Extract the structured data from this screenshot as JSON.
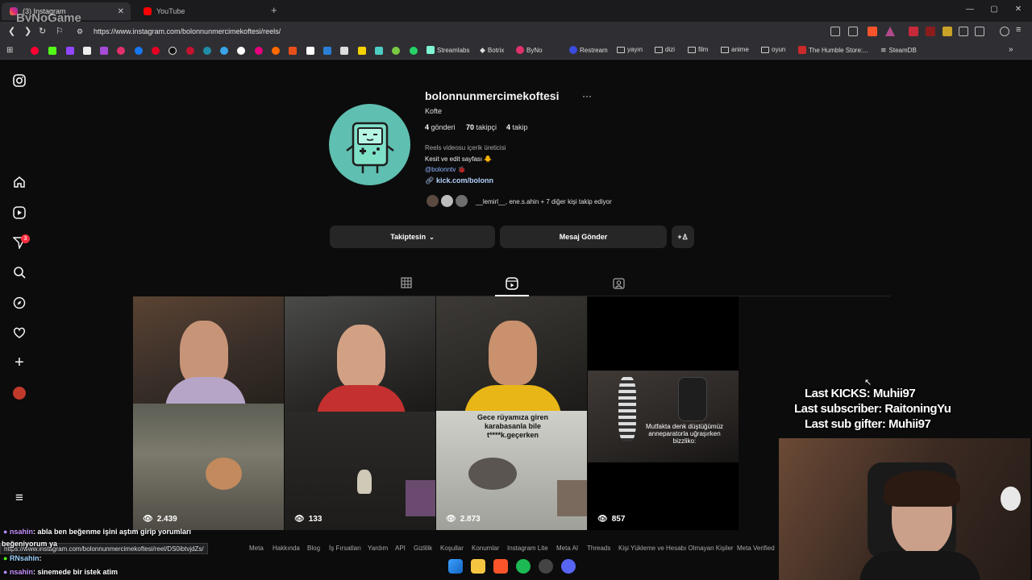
{
  "browser": {
    "tabs": [
      {
        "title": "(3) Instagram",
        "active": true
      },
      {
        "title": "YouTube",
        "active": false
      }
    ],
    "url": "https://www.instagram.com/bolonnunmercimekoftesi/reels/",
    "bookmarks": [
      "Streamlabs",
      "Botrix",
      "ByNo",
      "Restream",
      "yayın",
      "dizi",
      "film",
      "anime",
      "oyun",
      "The Humble Store:...",
      "SteamDB"
    ],
    "watermark": "ByNoGame"
  },
  "nav": {
    "notifications_count": "3"
  },
  "profile": {
    "username": "bolonnunmercimekoftesi",
    "full_name": "Kofte",
    "posts_count": "4",
    "posts_label": "gönderi",
    "followers_count": "70",
    "followers_label": "takipçi",
    "following_count": "4",
    "following_label": "takip",
    "category": "Reels videosu içerik üreticisi",
    "bio_line1": "Kesit ve edit sayfası 🐥",
    "bio_mention": "@bolonntv 🐞",
    "bio_link": "kick.com/bolonn",
    "mutual_text": "__lemirl__, ene.s.ahin + 7 diğer kişi takip ediyor",
    "following_button": "Takiptesin",
    "message_button": "Mesaj Gönder"
  },
  "reels": [
    {
      "views": "2.439",
      "caption": ""
    },
    {
      "views": "133",
      "caption": ""
    },
    {
      "views": "2.873",
      "caption": "Gece rüyamıza giren karabasanla bile t****k.geçerken"
    },
    {
      "views": "857",
      "caption": "Mutfakta denk düştüğümüz anneparatorla uğraşırken bizzliko:"
    }
  ],
  "footer": [
    "Meta",
    "Hakkında",
    "Blog",
    "İş Fırsatları",
    "Yardım",
    "API",
    "Gizlilik",
    "Koşullar",
    "Konumlar",
    "Instagram Lite",
    "Meta AI",
    "Threads",
    "Kişi Yükleme ve Hesabı Olmayan Kişiler",
    "Meta Verified"
  ],
  "stream_overlay": {
    "last_kicks": "Last KICKS: Muhii97",
    "last_subscriber": "Last subscriber: RaitoningYu",
    "last_sub_gifter": "Last sub gifter: Muhii97"
  },
  "chat": [
    {
      "user": "nsahin",
      "text": ": abla ben beğenme işini aştım girip yorumları"
    },
    {
      "user": "",
      "text": "beğeniyorum ya"
    },
    {
      "user": "RNsahin",
      "text": ":"
    },
    {
      "user": "nsahin",
      "text": ": sinemede bir istek atim"
    }
  ],
  "status_url": "https://www.instagram.com/bolonnunmercimekoftesi/reel/DS0ibtvjdZs/",
  "colors": {
    "accent": "#0095f6",
    "badge": "#ff3040",
    "bg": "#0c0c0c"
  }
}
